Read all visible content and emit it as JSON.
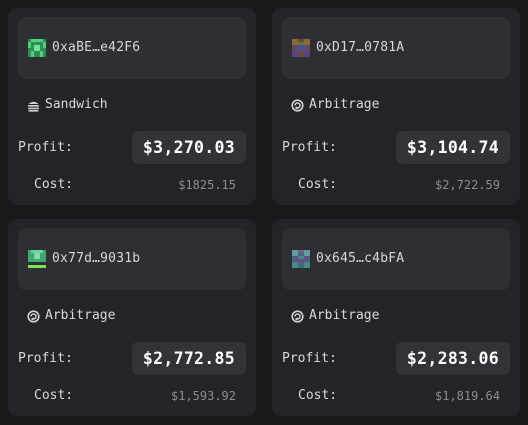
{
  "cards": [
    {
      "address": "0xaBE…e42F6",
      "avatar_icon": "identicon-green",
      "type": {
        "label": "Sandwich",
        "icon": "sandwich-icon"
      },
      "profit_label": "Profit:",
      "profit": "$3,270.03",
      "cost_label": "Cost:",
      "cost": "$1825.15"
    },
    {
      "address": "0xD17…0781A",
      "avatar_icon": "identicon-brown",
      "type": {
        "label": "Arbitrage",
        "icon": "arbitrage-icon"
      },
      "profit_label": "Profit:",
      "profit": "$3,104.74",
      "cost_label": "Cost:",
      "cost": "$2,722.59"
    },
    {
      "address": "0x77d…9031b",
      "avatar_icon": "identicon-lime",
      "type": {
        "label": "Arbitrage",
        "icon": "arbitrage-icon"
      },
      "profit_label": "Profit:",
      "profit": "$2,772.85",
      "cost_label": "Cost:",
      "cost": "$1,593.92"
    },
    {
      "address": "0x645…c4bFA",
      "avatar_icon": "identicon-teal",
      "type": {
        "label": "Arbitrage",
        "icon": "arbitrage-icon"
      },
      "profit_label": "Profit:",
      "profit": "$2,283.06",
      "cost_label": "Cost:",
      "cost": "$1,819.64"
    }
  ],
  "colors": {
    "background": "#18191b",
    "card": "#232427",
    "address_box": "#2e2f33",
    "profit_box": "#323337",
    "cost_text": "#8c8d92"
  }
}
